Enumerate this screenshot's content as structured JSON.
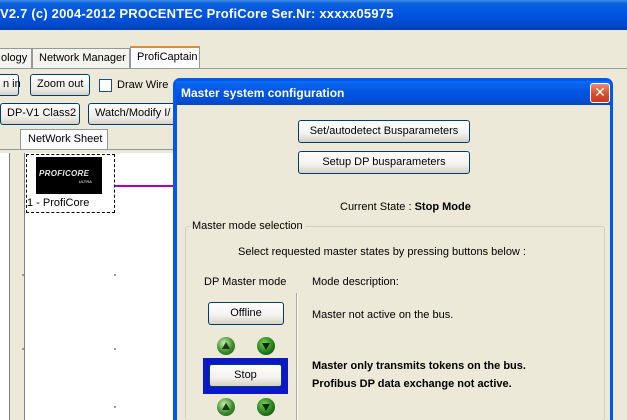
{
  "app": {
    "title": "V2.7 (c) 2004-2012 PROCENTEC  ProfiCore Ser.Nr: xxxxx05975"
  },
  "tabs": [
    {
      "label": "ology"
    },
    {
      "label": "Network Manager"
    },
    {
      "label": "ProfiCaptain",
      "active": true
    }
  ],
  "toolbar": {
    "zoom_in_label": "n in",
    "zoom_out_label": "Zoom out",
    "draw_wire_label": "Draw Wire",
    "draw_wire_checked": false,
    "dpv1_label": "DP-V1 Class2",
    "watch_label": "Watch/Modify I/"
  },
  "sheet": {
    "tab_label": "NetWork Sheet",
    "device": {
      "logo_text": "PROFICORE",
      "logo_sub": "ULTRA",
      "label": "1 - ProfiCore"
    }
  },
  "dialog": {
    "title": "Master system configuration",
    "close_glyph": "✕",
    "autodetect_label": "Set/autodetect Busparameters",
    "setup_label": "Setup DP busparameters",
    "state_label": "Current State : ",
    "state_value": "Stop Mode",
    "group_title": "Master mode selection",
    "instruction": "Select requested master states by pressing buttons below :",
    "col_mode": "DP Master mode",
    "col_desc": "Mode description:",
    "modes": [
      {
        "button": "Offline",
        "description": [
          "Master not active on the bus."
        ],
        "selected": false
      },
      {
        "button": "Stop",
        "description": [
          "Master only transmits tokens on the bus.",
          "Profibus DP data exchange not active."
        ],
        "selected": true
      }
    ]
  },
  "colors": {
    "titlebar": "#0054e3",
    "wire": "#b000b0",
    "selected_frame": "#0a18c8",
    "close_button": "#d44c2a"
  },
  "icons": [
    "arrow-up-icon",
    "arrow-down-icon",
    "close-icon",
    "proficore-logo"
  ]
}
